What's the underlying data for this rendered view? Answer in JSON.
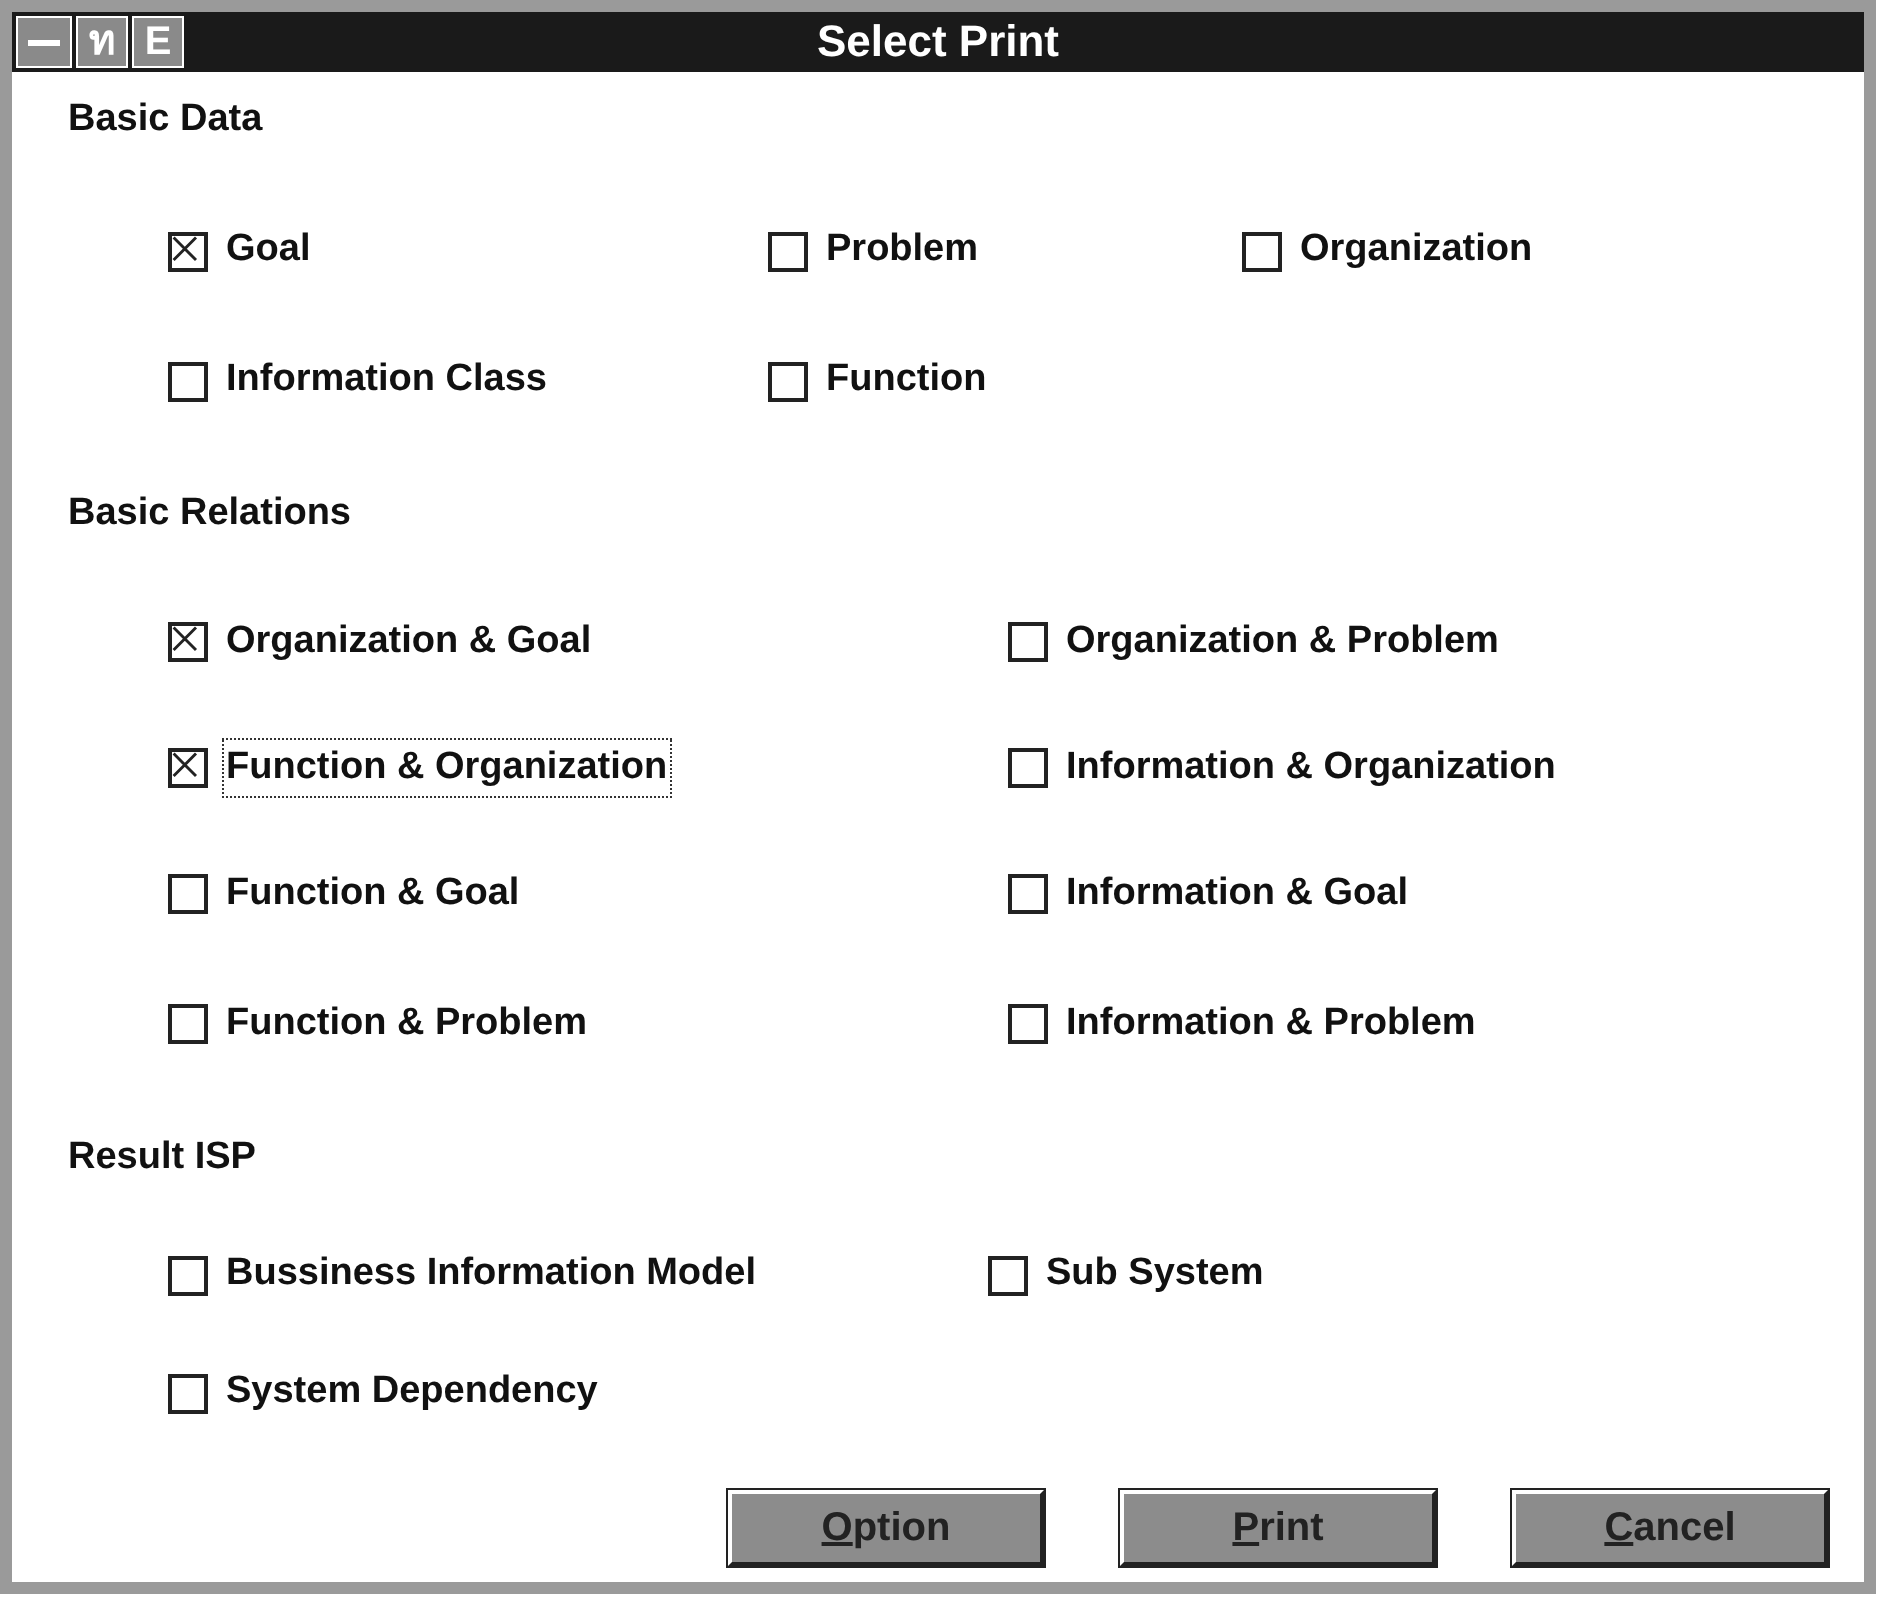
{
  "window": {
    "title": "Select Print",
    "title_buttons": [
      "ท",
      "E"
    ]
  },
  "sections": [
    {
      "title": "Basic Data",
      "rows": [
        [
          {
            "label": "Goal",
            "checked": true,
            "focused": false
          },
          {
            "label": "Problem",
            "checked": false,
            "focused": false
          },
          {
            "label": "Organization",
            "checked": false,
            "focused": false
          }
        ],
        [
          {
            "label": "Information Class",
            "checked": false,
            "focused": false
          },
          {
            "label": "Function",
            "checked": false,
            "focused": false
          }
        ]
      ]
    },
    {
      "title": "Basic Relations",
      "rows": [
        [
          {
            "label": "Organization & Goal",
            "checked": true,
            "focused": false
          },
          {
            "label": "Organization & Problem",
            "checked": false,
            "focused": false
          }
        ],
        [
          {
            "label": "Function & Organization",
            "checked": true,
            "focused": true
          },
          {
            "label": "Information & Organization",
            "checked": false,
            "focused": false
          }
        ],
        [
          {
            "label": "Function & Goal",
            "checked": false,
            "focused": false
          },
          {
            "label": "Information & Goal",
            "checked": false,
            "focused": false
          }
        ],
        [
          {
            "label": "Function & Problem",
            "checked": false,
            "focused": false
          },
          {
            "label": "Information & Problem",
            "checked": false,
            "focused": false
          }
        ]
      ]
    },
    {
      "title": "Result ISP",
      "rows": [
        [
          {
            "label": "Bussiness Information Model",
            "checked": false,
            "focused": false
          },
          {
            "label": "Sub System",
            "checked": false,
            "focused": false
          }
        ],
        [
          {
            "label": "System Dependency",
            "checked": false,
            "focused": false
          }
        ]
      ]
    }
  ],
  "buttons": [
    "Option",
    "Print",
    "Cancel"
  ]
}
